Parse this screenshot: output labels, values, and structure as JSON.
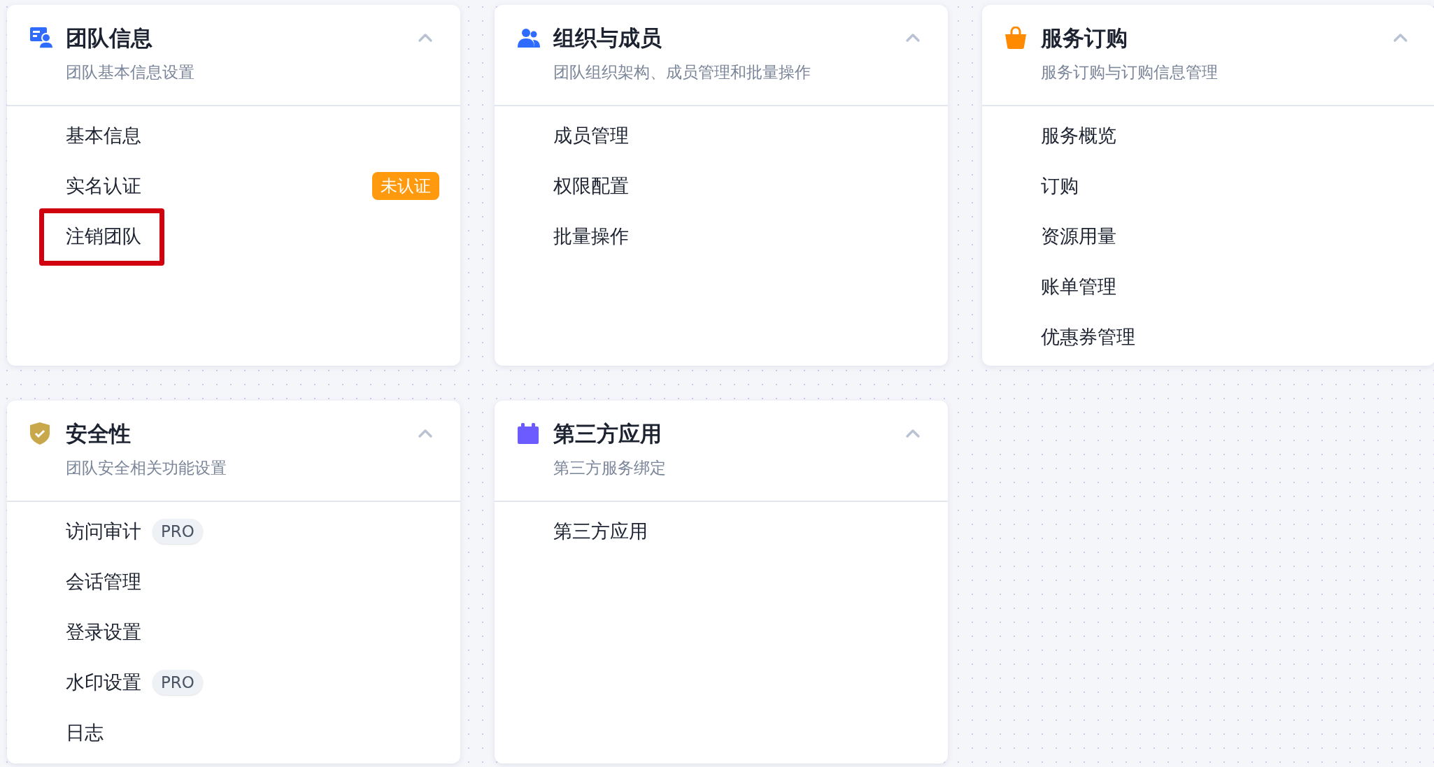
{
  "sections": [
    {
      "title": "团队信息",
      "subtitle": "团队基本信息设置",
      "expanded": true,
      "items": [
        {
          "label": "基本信息",
          "highlighted": false
        },
        {
          "label": "实名认证",
          "highlighted": false,
          "badge": {
            "text": "未认证",
            "kind": "status"
          }
        },
        {
          "label": "注销团队",
          "highlighted": true
        }
      ]
    },
    {
      "title": "组织与成员",
      "subtitle": "团队组织架构、成员管理和批量操作",
      "expanded": true,
      "items": [
        {
          "label": "成员管理",
          "highlighted": false
        },
        {
          "label": "权限配置",
          "highlighted": false
        },
        {
          "label": "批量操作",
          "highlighted": false
        }
      ]
    },
    {
      "title": "服务订购",
      "subtitle": "服务订购与订购信息管理",
      "expanded": true,
      "items": [
        {
          "label": "服务概览",
          "highlighted": false
        },
        {
          "label": "订购",
          "highlighted": false
        },
        {
          "label": "资源用量",
          "highlighted": false
        },
        {
          "label": "账单管理",
          "highlighted": false
        },
        {
          "label": "优惠券管理",
          "highlighted": false
        }
      ]
    },
    {
      "title": "安全性",
      "subtitle": "团队安全相关功能设置",
      "expanded": true,
      "items": [
        {
          "label": "访问审计",
          "highlighted": false,
          "badge": {
            "text": "PRO",
            "kind": "pro"
          }
        },
        {
          "label": "会话管理",
          "highlighted": false
        },
        {
          "label": "登录设置",
          "highlighted": false
        },
        {
          "label": "水印设置",
          "highlighted": false,
          "badge": {
            "text": "PRO",
            "kind": "pro"
          }
        },
        {
          "label": "日志",
          "highlighted": false
        }
      ]
    },
    {
      "title": "第三方应用",
      "subtitle": "第三方服务绑定",
      "expanded": true,
      "items": [
        {
          "label": "第三方应用",
          "highlighted": false
        }
      ]
    }
  ]
}
